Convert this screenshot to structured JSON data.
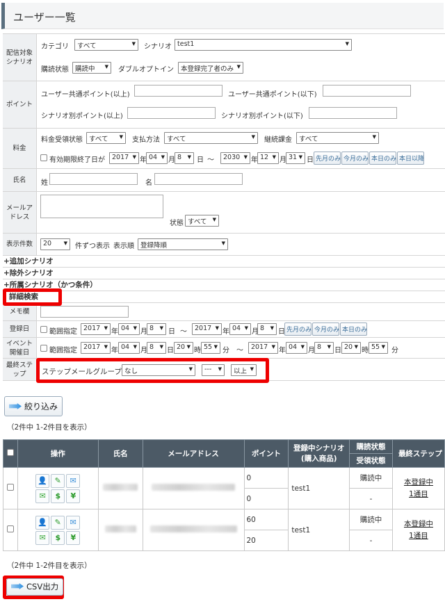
{
  "header": {
    "title": "ユーザー一覧"
  },
  "form": {
    "delivery": {
      "label": "配信対象\nシナリオ",
      "category_label": "カテゴリ",
      "category_value": "すべて",
      "scenario_label": "シナリオ",
      "scenario_value": "test1",
      "subscribe_label": "購読状態",
      "subscribe_value": "購読中",
      "doubleoptin_label": "ダブルオプトイン",
      "doubleoptin_value": "本登録完了者のみ"
    },
    "point": {
      "label": "ポイント",
      "common_min": "ユーザー共通ポイント(以上)",
      "common_max": "ユーザー共通ポイント(以下)",
      "scenario_min": "シナリオ別ポイント(以上)",
      "scenario_max": "シナリオ別ポイント(以下)"
    },
    "fee": {
      "label": "料金",
      "receive_label": "料金受領状態",
      "receive_value": "すべて",
      "method_label": "支払方法",
      "method_value": "すべて",
      "recurring_label": "継続課金",
      "recurring_value": "すべて",
      "expiry_label": "有効期限終了日が",
      "from_year": "2017",
      "from_month": "04",
      "from_day": "8",
      "to_year": "2030",
      "to_month": "12",
      "to_day": "31",
      "year": "年",
      "month": "月",
      "day": "日",
      "tilde": "～",
      "btn_before": "先月のみ",
      "btn_month": "今月のみ",
      "btn_today": "本日のみ",
      "btn_after": "本日以降"
    },
    "name": {
      "label": "氏名",
      "last": "姓",
      "first": "名"
    },
    "mail": {
      "label": "メールア\nドレス",
      "status_label": "状態",
      "status_value": "すべて"
    },
    "display": {
      "label": "表示件数",
      "count": "20",
      "per_label": "件ずつ表示",
      "order_label": "表示順",
      "order_value": "登録降順"
    }
  },
  "expanders": {
    "add": "+追加シナリオ",
    "exclude": "+除外シナリオ",
    "belong": "+所属シナリオ（かつ条件）",
    "detail": "- 詳細検索"
  },
  "detail": {
    "memo_label": "メモ欄",
    "reg_label": "登録日",
    "range": "範囲指定",
    "reg_from": {
      "y": "2017",
      "m": "04",
      "d": "8"
    },
    "reg_to": {
      "y": "2017",
      "m": "04",
      "d": "8"
    },
    "reg_btn1": "先月のみ",
    "reg_btn2": "今月のみ",
    "reg_btn3": "本日のみ",
    "event_label": "イベント\n開催日",
    "ev_from": {
      "y": "2017",
      "m": "04",
      "d": "8",
      "h": "20",
      "min": "55"
    },
    "ev_to": {
      "y": "2017",
      "m": "04",
      "d": "8",
      "h": "20",
      "min": "55"
    },
    "hour": "時",
    "minute": "分",
    "step_label": "最終ステ\nップ",
    "step_group_label": "ステップメールグループ",
    "step_group_value": "なし",
    "step_num_value": "---",
    "step_cmp_value": "以上"
  },
  "filter_button": "絞り込み",
  "count_text": "（2件中 1-2件目を表示）",
  "table": {
    "headers": {
      "op": "操作",
      "name": "氏名",
      "mail": "メールアドレス",
      "point": "ポイント",
      "scenario": "登録中シナリオ\n(購入商品)",
      "sub_status": "購読状態",
      "recv_status": "受領状態",
      "last_step": "最終ステップ"
    },
    "rows": [
      {
        "point1": "0",
        "point2": "0",
        "scenario": "test1",
        "sub": "購読中",
        "recv": "-",
        "step1": "本登録中",
        "step2": "1通目"
      },
      {
        "point1": "60",
        "point2": "20",
        "scenario": "test1",
        "sub": "購読中",
        "recv": "-",
        "step1": "本登録中",
        "step2": "1通目"
      }
    ],
    "icons": {
      "profile": "👤",
      "edit": "✎",
      "mail": "✉",
      "dollar": "$",
      "yen": "¥"
    }
  },
  "csv_button": "CSV出力"
}
